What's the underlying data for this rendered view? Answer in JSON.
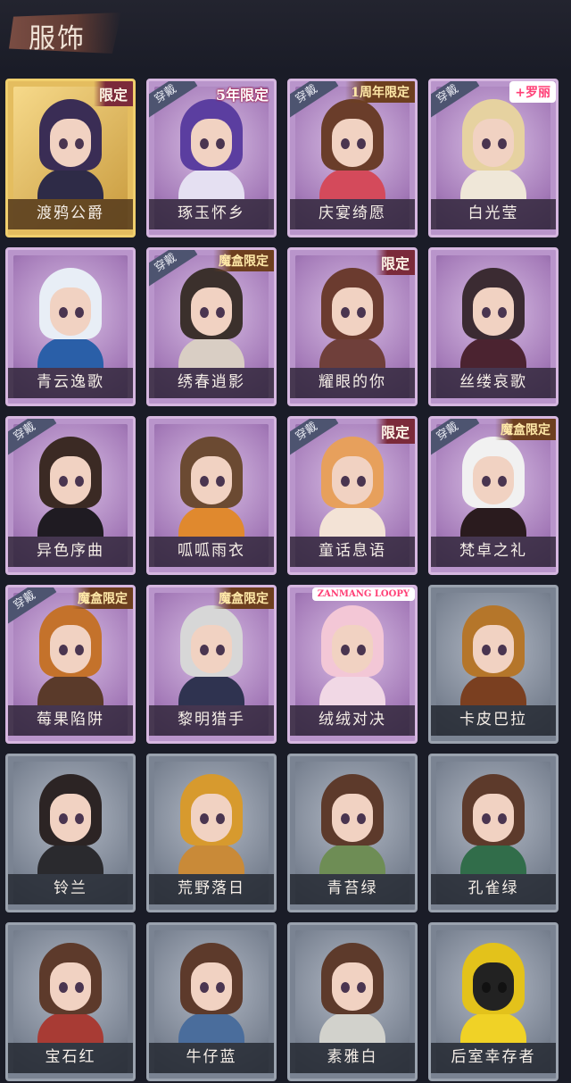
{
  "header": {
    "title": "服饰"
  },
  "labels": {
    "worn": "穿戴",
    "limited": "限定",
    "five_year_limited": "5年限定",
    "first_anniv_limited": "1周年限定",
    "box_limited": "魔盒限定",
    "luo_li": "+罗丽",
    "loopy": "ZANMANG LOOPY"
  },
  "items": [
    {
      "name": "渡鸦公爵",
      "frame": "gold",
      "worn": false,
      "badge": "限定"
    },
    {
      "name": "琢玉怀乡",
      "frame": "purple",
      "worn": true,
      "badge": "5年限定"
    },
    {
      "name": "庆宴绮愿",
      "frame": "purple",
      "worn": true,
      "badge": "1周年限定"
    },
    {
      "name": "白光莹",
      "frame": "purple",
      "worn": true,
      "badge": "+罗丽"
    },
    {
      "name": "青云逸歌",
      "frame": "purple",
      "worn": false,
      "badge": ""
    },
    {
      "name": "绣春逍影",
      "frame": "purple",
      "worn": true,
      "badge": "魔盒限定"
    },
    {
      "name": "耀眼的你",
      "frame": "purple",
      "worn": false,
      "badge": "限定"
    },
    {
      "name": "丝缕哀歌",
      "frame": "purple",
      "worn": false,
      "badge": ""
    },
    {
      "name": "异色序曲",
      "frame": "purple",
      "worn": true,
      "badge": ""
    },
    {
      "name": "呱呱雨衣",
      "frame": "purple",
      "worn": false,
      "badge": ""
    },
    {
      "name": "童话息语",
      "frame": "purple",
      "worn": true,
      "badge": "限定"
    },
    {
      "name": "梵卓之礼",
      "frame": "purple",
      "worn": true,
      "badge": "魔盒限定"
    },
    {
      "name": "莓果陷阱",
      "frame": "purple",
      "worn": true,
      "badge": "魔盒限定"
    },
    {
      "name": "黎明猎手",
      "frame": "purple",
      "worn": false,
      "badge": "魔盒限定"
    },
    {
      "name": "绒绒对决",
      "frame": "purple",
      "worn": false,
      "badge": "ZANMANG LOOPY"
    },
    {
      "name": "卡皮巴拉",
      "frame": "grey",
      "worn": false,
      "badge": ""
    },
    {
      "name": "铃兰",
      "frame": "grey",
      "worn": false,
      "badge": ""
    },
    {
      "name": "荒野落日",
      "frame": "grey",
      "worn": false,
      "badge": ""
    },
    {
      "name": "青苔绿",
      "frame": "grey",
      "worn": false,
      "badge": ""
    },
    {
      "name": "孔雀绿",
      "frame": "grey",
      "worn": false,
      "badge": ""
    },
    {
      "name": "宝石红",
      "frame": "grey",
      "worn": false,
      "badge": ""
    },
    {
      "name": "牛仔蓝",
      "frame": "grey",
      "worn": false,
      "badge": ""
    },
    {
      "name": "素雅白",
      "frame": "grey",
      "worn": false,
      "badge": ""
    },
    {
      "name": "后室幸存者",
      "frame": "grey",
      "worn": false,
      "badge": ""
    }
  ],
  "colors": {
    "background": "#1a1c27",
    "gold_frame": "#f0cf6d",
    "purple_frame": "#d6b7e0",
    "grey_frame": "#9aa2ae"
  }
}
